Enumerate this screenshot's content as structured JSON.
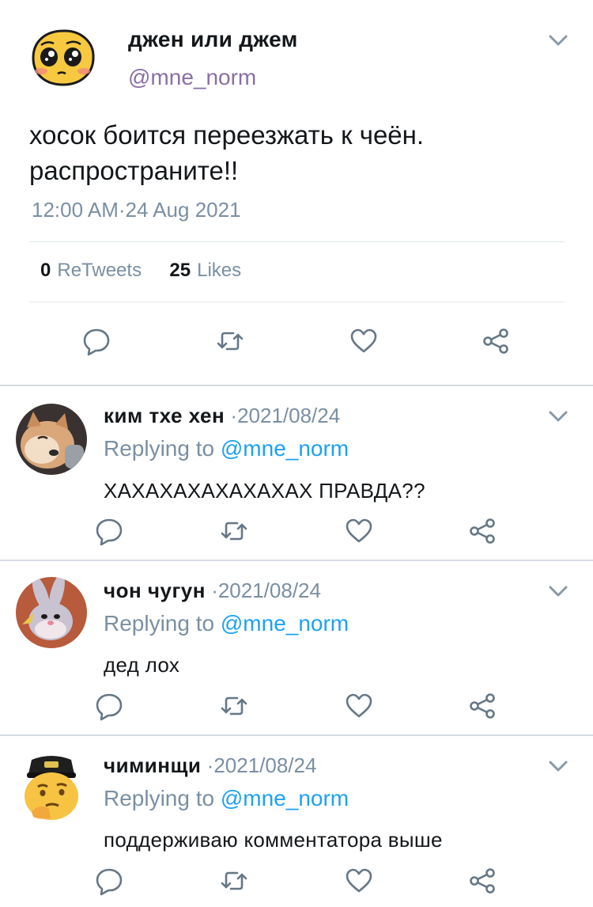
{
  "main": {
    "name": "джен или джем",
    "handle": "@mne_norm",
    "text": "хосок боится переезжать к чеён. распространите!!",
    "time": "12:00 AM·24 Aug 2021",
    "retweets_count": "0",
    "retweets_label": "ReTweets",
    "likes_count": "25",
    "likes_label": "Likes"
  },
  "replies": [
    {
      "name": "ким тхе хен",
      "date": "·2021/08/24",
      "replying_prefix": "Replying to",
      "mention": "@mne_norm",
      "text": "ХАХАХАХАХАХАХАХ ПРАВДА??"
    },
    {
      "name": "чон чугун",
      "date": "·2021/08/24",
      "replying_prefix": "Replying to",
      "mention": "@mne_norm",
      "text": "дед лох"
    },
    {
      "name": "чиминщи",
      "date": "·2021/08/24",
      "replying_prefix": "Replying to",
      "mention": "@mne_norm",
      "text": "поддерживаю комментатора выше"
    }
  ],
  "icons": {
    "reply": "reply-icon",
    "retweet": "retweet-icon",
    "like": "heart-icon",
    "share": "share-icon",
    "more": "chevron-down-icon"
  },
  "colors": {
    "text": "#14171a",
    "secondary": "#7a8fa3",
    "handle": "#8a6fa3",
    "mention": "#1da1f2",
    "divider": "#e1e8ed"
  }
}
